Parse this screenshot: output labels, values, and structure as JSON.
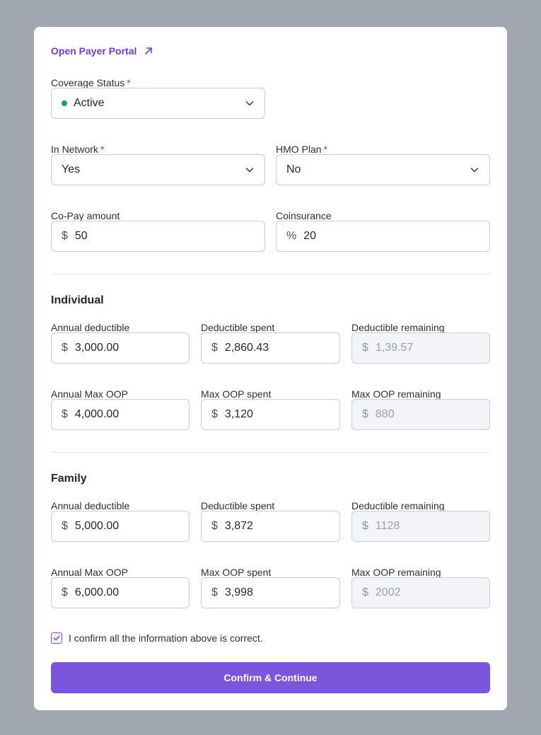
{
  "portal_link": {
    "label": "Open Payer Portal"
  },
  "coverage_status": {
    "label": "Coverage Status",
    "required": "*",
    "value": "Active"
  },
  "in_network": {
    "label": "In Network",
    "required": "*",
    "value": "Yes"
  },
  "hmo_plan": {
    "label": "HMO Plan",
    "required": "*",
    "value": "No"
  },
  "copay": {
    "label": "Co-Pay amount",
    "prefix": "$",
    "value": "50"
  },
  "coinsurance": {
    "label": "Coinsurance",
    "prefix": "%",
    "value": "20"
  },
  "individual": {
    "title": "Individual",
    "annual_deductible": {
      "label": "Annual deductible",
      "prefix": "$",
      "value": "3,000.00"
    },
    "deductible_spent": {
      "label": "Deductible spent",
      "prefix": "$",
      "value": "2,860.43"
    },
    "deductible_remaining": {
      "label": "Deductible remaining",
      "prefix": "$",
      "value": "1,39.57"
    },
    "annual_max_oop": {
      "label": "Annual Max OOP",
      "prefix": "$",
      "value": "4,000.00"
    },
    "max_oop_spent": {
      "label": "Max OOP spent",
      "prefix": "$",
      "value": "3,120"
    },
    "max_oop_remaining": {
      "label": "Max OOP remaining",
      "prefix": "$",
      "value": "880"
    }
  },
  "family": {
    "title": "Family",
    "annual_deductible": {
      "label": "Annual deductible",
      "prefix": "$",
      "value": "5,000.00"
    },
    "deductible_spent": {
      "label": "Deductible spent",
      "prefix": "$",
      "value": "3,872"
    },
    "deductible_remaining": {
      "label": "Deductible remaining",
      "prefix": "$",
      "value": "1128"
    },
    "annual_max_oop": {
      "label": "Annual Max OOP",
      "prefix": "$",
      "value": "6,000.00"
    },
    "max_oop_spent": {
      "label": "Max OOP spent",
      "prefix": "$",
      "value": "3,998"
    },
    "max_oop_remaining": {
      "label": "Max OOP remaining",
      "prefix": "$",
      "value": "2002"
    }
  },
  "confirmation": {
    "label": "I confirm all the information above is correct.",
    "checked": true
  },
  "cta": {
    "label": "Confirm & Continue"
  },
  "colors": {
    "accent": "#7b55dc",
    "link": "#6b3fd1",
    "active_dot": "#1aa35a",
    "required": "#e0342f"
  }
}
